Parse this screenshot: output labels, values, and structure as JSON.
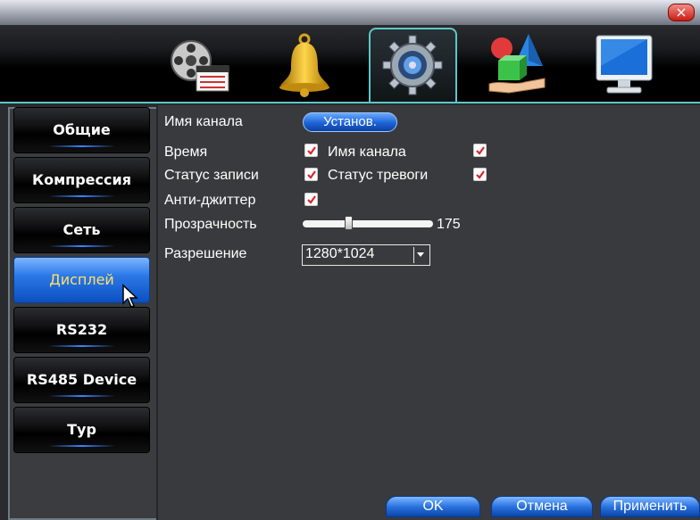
{
  "window": {
    "close_glyph": "×"
  },
  "top_tabs": [
    {
      "name": "record-icon"
    },
    {
      "name": "alarm-bell-icon"
    },
    {
      "name": "settings-gear-icon",
      "active": true
    },
    {
      "name": "tools-icon"
    },
    {
      "name": "monitor-icon"
    }
  ],
  "sidebar": {
    "items": [
      {
        "label": "Общие"
      },
      {
        "label": "Компрессия"
      },
      {
        "label": "Сеть"
      },
      {
        "label": "Дисплей",
        "active": true
      },
      {
        "label": "RS232"
      },
      {
        "label": "RS485 Device"
      },
      {
        "label": "Тур"
      }
    ]
  },
  "display": {
    "channel_name_label": "Имя канала",
    "channel_name_button": "Установ.",
    "time_label": "Время",
    "time_checked": true,
    "channel_name_overlay_label": "Имя канала",
    "channel_name_overlay_checked": true,
    "record_status_label": "Статус записи",
    "record_status_checked": true,
    "alarm_status_label": "Статус тревоги",
    "alarm_status_checked": true,
    "anti_jitter_label": "Анти-джиттер",
    "anti_jitter_checked": true,
    "transparency_label": "Прозрачность",
    "transparency_value": "175",
    "resolution_label": "Разрешение",
    "resolution_value": "1280*1024"
  },
  "footer": {
    "ok_label": "OK",
    "cancel_label": "Отмена",
    "apply_label": "Применить"
  },
  "colors": {
    "accent": "#5cc8c8",
    "active_blue": "#2b78e8",
    "active_text": "#ffe066",
    "check_red": "#d8262c"
  }
}
